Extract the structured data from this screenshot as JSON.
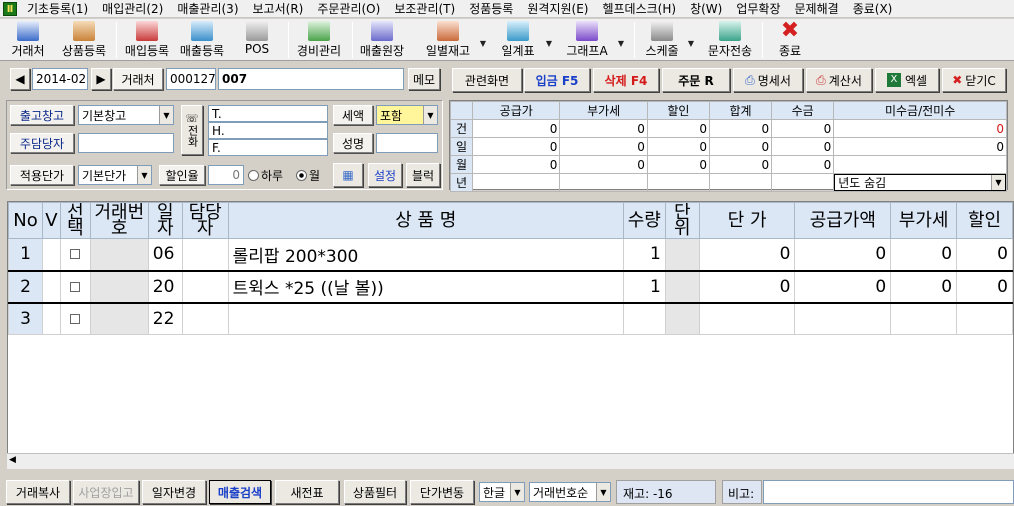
{
  "menu": [
    "기초등록(1)",
    "매입관리(2)",
    "매출관리(3)",
    "보고서(R)",
    "주문관리(O)",
    "보조관리(T)",
    "정품등록",
    "원격지원(E)",
    "헬프데스크(H)",
    "창(W)",
    "업무확장",
    "문제해결",
    "종료(X)"
  ],
  "toolbar": {
    "items": [
      {
        "label": "거래처",
        "icon": "customer-icon",
        "color": "#3a6bc9"
      },
      {
        "label": "상품등록",
        "icon": "product-box-icon",
        "color": "#c9833a"
      },
      {
        "label": "매입등록",
        "icon": "purchase-icon",
        "color": "#c93a3a"
      },
      {
        "label": "매출등록",
        "icon": "sales-icon",
        "color": "#3a8fc9"
      },
      {
        "label": "POS",
        "icon": "pos-icon",
        "color": "#9a9a9a"
      },
      {
        "label": "경비관리",
        "icon": "expense-icon",
        "color": "#4aa34a"
      },
      {
        "label": "매출원장",
        "icon": "ledger-icon",
        "color": "#6a6acb"
      },
      {
        "label": "일별재고",
        "icon": "calendar-icon",
        "color": "#c96a3a"
      },
      {
        "label": "일계표",
        "icon": "daily-report-icon",
        "color": "#3a9ac9"
      },
      {
        "label": "그래프A",
        "icon": "bar-chart-icon",
        "color": "#7a4ac9"
      },
      {
        "label": "스케줄",
        "icon": "schedule-icon",
        "color": "#8a8a8a"
      },
      {
        "label": "문자전송",
        "icon": "sms-icon",
        "color": "#3aa38a"
      },
      {
        "label": "종료",
        "icon": "close-x-icon",
        "color": "#d42020"
      }
    ]
  },
  "header": {
    "date": "2014-02",
    "customer_label": "거래처",
    "customer_code": "000127",
    "customer_name": "007",
    "memo": "메모"
  },
  "actions": {
    "related": "관련화면",
    "deposit": "입금 F5",
    "delete": "삭제 F4",
    "order": "주문 R",
    "statement": "명세서",
    "invoice": "계산서",
    "excel": "엑셀",
    "close": "닫기C"
  },
  "form": {
    "warehouse_label": "출고창고",
    "warehouse_value": "기본창고",
    "manager_label": "주담당자",
    "manager_value": "",
    "price_label": "적용단가",
    "price_value": "기본단가",
    "discount_label": "할인율",
    "discount_value": "0",
    "radio_day": "하루",
    "radio_month": "월",
    "phone_label": "전화",
    "tel": "T.",
    "hp": "H.",
    "fax": "F.",
    "tax_label": "세액",
    "tax_value": "포함",
    "name_label": "성명",
    "name_value": "",
    "setting": "설정",
    "block": "블럭"
  },
  "summary": {
    "headers": [
      "공급가",
      "부가세",
      "할인",
      "합계",
      "수금",
      "미수금/전미수"
    ],
    "rows": [
      {
        "label": "건",
        "values": [
          "0",
          "0",
          "0",
          "0",
          "0",
          "0"
        ]
      },
      {
        "label": "일",
        "values": [
          "0",
          "0",
          "0",
          "0",
          "0",
          "0"
        ]
      },
      {
        "label": "월",
        "values": [
          "0",
          "0",
          "0",
          "0",
          "0",
          ""
        ]
      },
      {
        "label": "년",
        "values": [
          "",
          "",
          "",
          "",
          "",
          ""
        ]
      }
    ],
    "year_combo": "년도 숨김"
  },
  "grid": {
    "headers": [
      "No",
      "V",
      "선택",
      "거래번호",
      "일자",
      "담당자",
      "상 품 명",
      "수량",
      "단위",
      "단 가",
      "공급가액",
      "부가세",
      "할인"
    ],
    "rows": [
      {
        "no": "1",
        "day": "06",
        "name": "롤리팝 200*300",
        "qty": "1",
        "price": "0",
        "supply": "0",
        "vat": "0",
        "disc": "0"
      },
      {
        "no": "2",
        "day": "20",
        "name": "트윅스 *25 ((날 볼))",
        "qty": "1",
        "price": "0",
        "supply": "0",
        "vat": "0",
        "disc": "0"
      },
      {
        "no": "3",
        "day": "22",
        "name": "",
        "qty": "",
        "price": "",
        "supply": "",
        "vat": "",
        "disc": ""
      }
    ]
  },
  "bottom": {
    "copy": "거래복사",
    "store_in": "사업장입고",
    "date_change": "일자변경",
    "sales_search": "매출검색",
    "new_slip": "새전표",
    "product_filter": "상품필터",
    "price_change": "단가변동",
    "ime": "한글",
    "sort": "거래번호순",
    "stock": "재고: -16",
    "note_label": "비고:",
    "note_value": ""
  }
}
